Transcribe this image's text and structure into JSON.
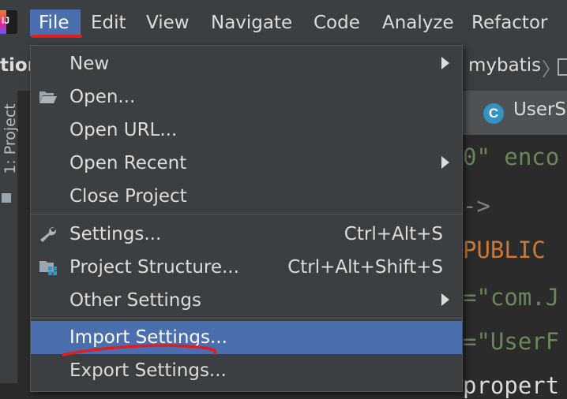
{
  "menubar": {
    "items": [
      "File",
      "Edit",
      "View",
      "Navigate",
      "Code",
      "Analyze",
      "Refactor"
    ]
  },
  "background": {
    "tool_window_label": "tion",
    "breadcrumb": "mybatis",
    "side_label": "1: Project",
    "tab_label": "UserSe",
    "class_icon_letter": "C",
    "code_lines": [
      "0\" enco",
      "->",
      "PUBLIC",
      "=\"com.J",
      "=\"UserF",
      "propert"
    ]
  },
  "menu": {
    "items": [
      {
        "label": "New",
        "shortcut": "",
        "submenu": true
      },
      {
        "label": "Open...",
        "shortcut": "",
        "submenu": false
      },
      {
        "label": "Open URL...",
        "shortcut": "",
        "submenu": false
      },
      {
        "label": "Open Recent",
        "shortcut": "",
        "submenu": true
      },
      {
        "label": "Close Project",
        "shortcut": "",
        "submenu": false
      },
      {
        "label": "Settings...",
        "shortcut": "Ctrl+Alt+S",
        "submenu": false
      },
      {
        "label": "Project Structure...",
        "shortcut": "Ctrl+Alt+Shift+S",
        "submenu": false
      },
      {
        "label": "Other Settings",
        "shortcut": "",
        "submenu": true
      },
      {
        "label": "Import Settings...",
        "shortcut": "",
        "submenu": false
      },
      {
        "label": "Export Settings...",
        "shortcut": "",
        "submenu": false
      }
    ]
  },
  "colors": {
    "menu_bg": "#3c3f41",
    "selection": "#4b6eaf",
    "annotation": "#e01e1e"
  }
}
